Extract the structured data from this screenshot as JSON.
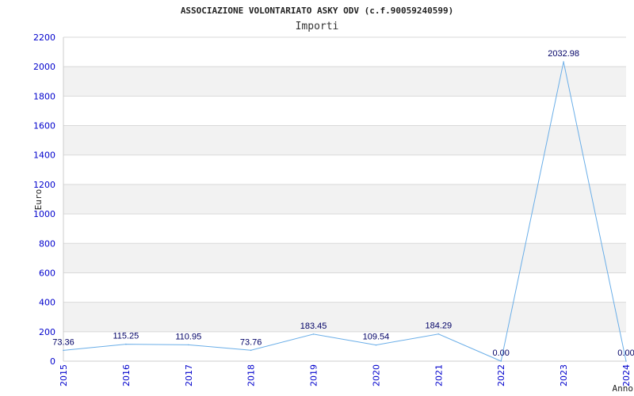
{
  "chart_data": {
    "type": "line",
    "title": "ASSOCIAZIONE VOLONTARIATO ASKY ODV (c.f.90059240599)",
    "subtitle": "Importi",
    "xlabel": "Anno",
    "ylabel": "Euro",
    "categories": [
      "2015",
      "2016",
      "2017",
      "2018",
      "2019",
      "2020",
      "2021",
      "2022",
      "2023",
      "2024"
    ],
    "series": [
      {
        "values": [
          73.36,
          115.25,
          110.95,
          73.76,
          183.45,
          109.54,
          184.29,
          0.0,
          2032.98,
          0.0
        ]
      }
    ],
    "data_labels": [
      "73.36",
      "115.25",
      "110.95",
      "73.76",
      "183.45",
      "109.54",
      "184.29",
      "0.00",
      "2032.98",
      "0.00"
    ],
    "yticks": [
      0,
      200,
      400,
      600,
      800,
      1000,
      1200,
      1400,
      1600,
      1800,
      2000,
      2200
    ],
    "ylim": [
      0,
      2200
    ],
    "grid": true,
    "colors": {
      "line": "#6aaee8",
      "band": "#f2f2f2",
      "gridline": "#d9d9d9",
      "axis": "#cccccc",
      "tick_text": "#0000cc",
      "label_text": "#000066"
    }
  }
}
